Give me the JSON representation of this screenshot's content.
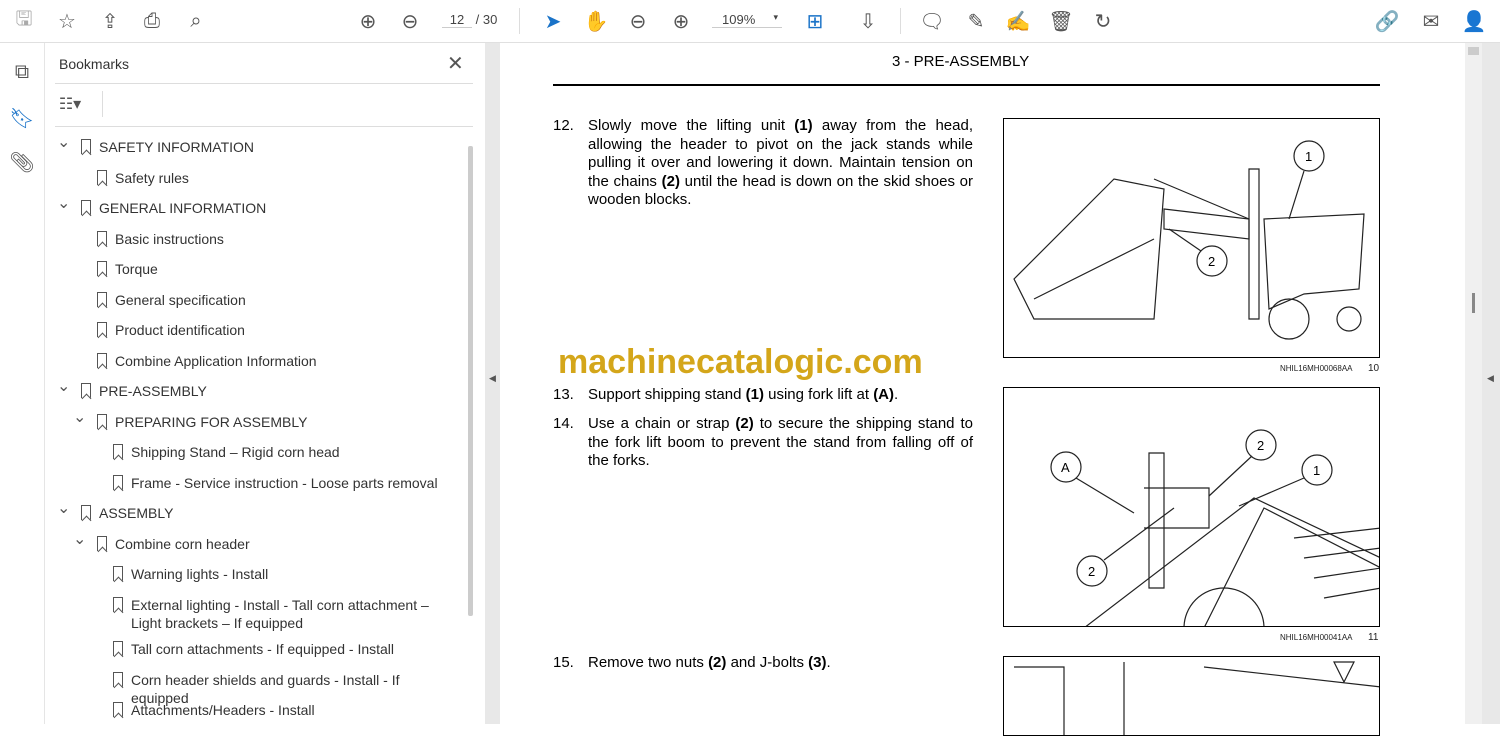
{
  "toolbar": {
    "page_current": "12",
    "page_total": "/ 30",
    "zoom": "109%"
  },
  "bookmarks": {
    "title": "Bookmarks",
    "items": [
      {
        "label": "SAFETY INFORMATION",
        "level": 0,
        "expanded": true
      },
      {
        "label": "Safety rules",
        "level": 1
      },
      {
        "label": "GENERAL INFORMATION",
        "level": 0,
        "expanded": true
      },
      {
        "label": "Basic instructions",
        "level": 1
      },
      {
        "label": "Torque",
        "level": 1
      },
      {
        "label": "General specification",
        "level": 1
      },
      {
        "label": "Product identification",
        "level": 1
      },
      {
        "label": "Combine Application Information",
        "level": 1
      },
      {
        "label": "PRE-ASSEMBLY",
        "level": 0,
        "expanded": true
      },
      {
        "label": "PREPARING FOR ASSEMBLY",
        "level": 1,
        "expanded": true
      },
      {
        "label": "Shipping Stand – Rigid corn head",
        "level": 2
      },
      {
        "label": "Frame - Service instruction - Loose parts removal",
        "level": 2
      },
      {
        "label": "ASSEMBLY",
        "level": 0,
        "expanded": true
      },
      {
        "label": "Combine corn header",
        "level": 1,
        "expanded": true
      },
      {
        "label": "Warning lights - Install",
        "level": 2
      },
      {
        "label": "External lighting - Install - Tall corn attachment – Light brackets – If equipped",
        "level": 2
      },
      {
        "label": "Tall corn attachments - If equipped - Install",
        "level": 2
      },
      {
        "label": "Corn header shields and guards - Install - If equipped",
        "level": 2
      },
      {
        "label": "Attachments/Headers - Install",
        "level": 2
      }
    ]
  },
  "document": {
    "header": "3 - PRE-ASSEMBLY",
    "watermark": "machinecatalogic.com",
    "steps": [
      {
        "num": "12.",
        "text": "Slowly move the lifting unit (1) away from the head, allowing the header to pivot on the jack stands while pulling it over and lowering it down. Maintain tension on the chains (2) until the head is down on the skid shoes or wooden blocks."
      },
      {
        "num": "13.",
        "text": "Support shipping stand (1) using fork lift at (A)."
      },
      {
        "num": "14.",
        "text": "Use a chain or strap (2) to secure the shipping stand to the fork lift boom to prevent the stand from falling off of the forks."
      },
      {
        "num": "15.",
        "text": "Remove two nuts (2) and J-bolts (3)."
      }
    ],
    "figures": [
      {
        "code": "NHIL16MH00068AA",
        "num": "10",
        "callouts": [
          "1",
          "2"
        ]
      },
      {
        "code": "NHIL16MH00041AA",
        "num": "11",
        "callouts": [
          "A",
          "2",
          "1",
          "2"
        ]
      }
    ]
  }
}
